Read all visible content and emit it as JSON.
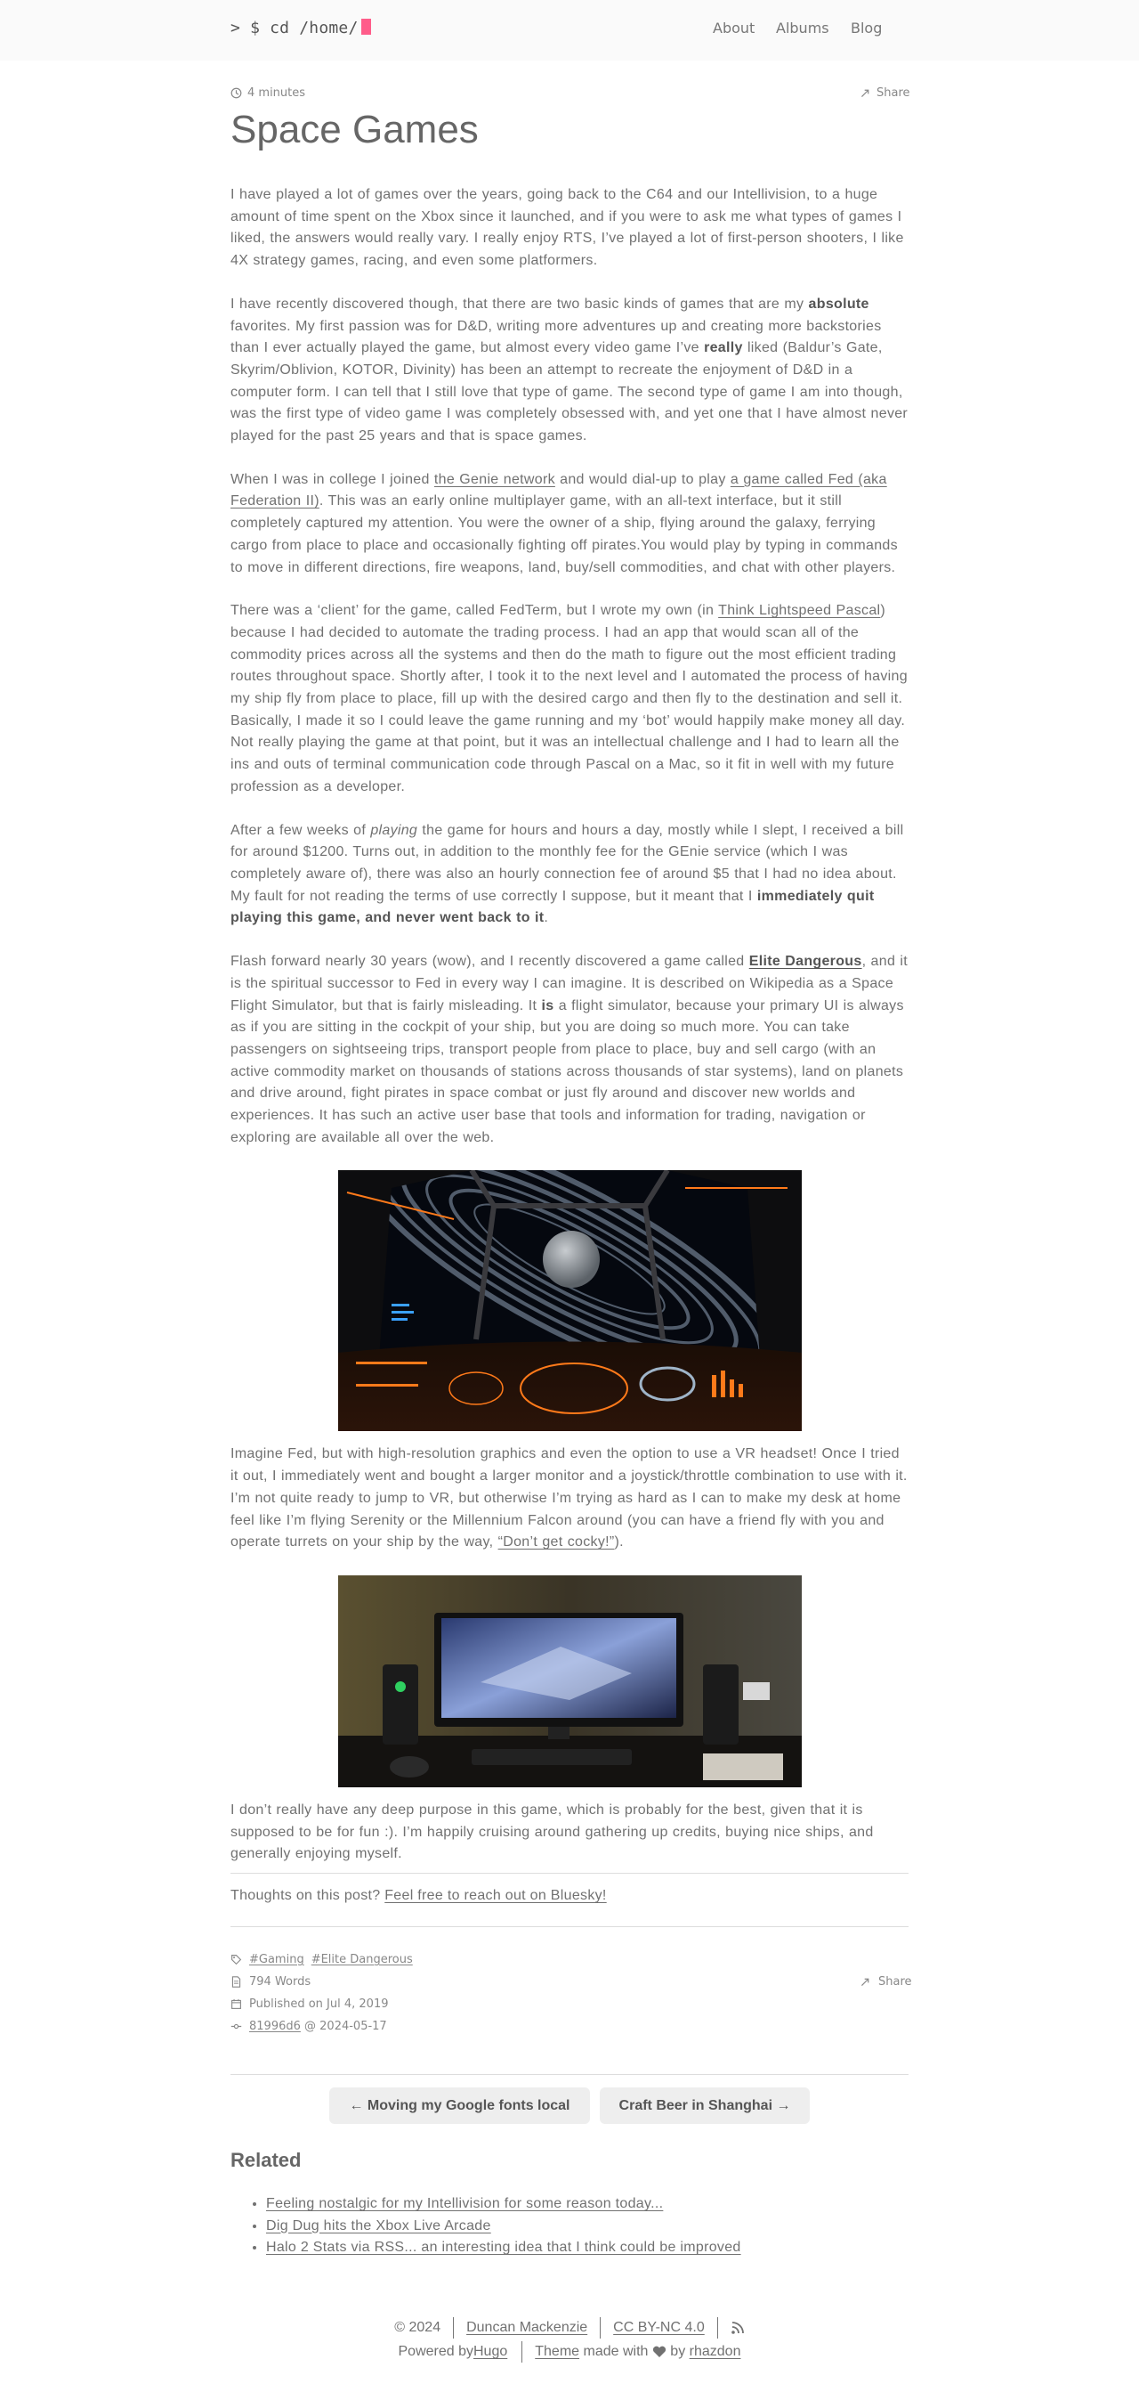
{
  "site": {
    "logo": "> $ cd /home/",
    "nav": [
      "About",
      "Albums",
      "Blog"
    ]
  },
  "post": {
    "reading_time": "4 minutes",
    "share_label": "Share",
    "title": "Space Games"
  },
  "content": {
    "p1": "I have played a lot of games over the years, going back to the C64 and our Intellivision, to a huge amount of time spent on the Xbox since it launched, and if you were to ask me what types of games I liked, the answers would really vary. I really enjoy RTS, I’ve played a lot of first-person shooters, I like 4X strategy games, racing, and even some platformers.",
    "p2_a": "I have recently discovered though, that there are two basic kinds of games that are my ",
    "p2_b": "absolute",
    "p2_c": " favorites. My first passion was for D&D, writing more adventures up and creating more backstories than I ever actually played the game, but almost every video game I’ve ",
    "p2_d": "really",
    "p2_e": " liked (Baldur’s Gate, Skyrim/Oblivion, KOTOR, Divinity) has been an attempt to recreate the enjoyment of D&D in a computer form. I can tell that I still love that type of game. The second type of game I am into though, was the first type of video game I was completely obsessed with, and yet one that I have almost never played for the past 25 years and that is space games.",
    "p3_a": "When I was in college I joined ",
    "p3_link1": "the Genie network",
    "p3_b": " and would dial-up to play ",
    "p3_link2": "a game called Fed (aka Federation II)",
    "p3_c": ". This was an early online multiplayer game, with an all-text interface, but it still completely captured my attention. You were the owner of a ship, flying around the galaxy, ferrying cargo from place to place and occasionally fighting off pirates.You would play by typing in commands to move in different directions, fire weapons, land, buy/sell commodities, and chat with other players.",
    "p4_a": "There was a ‘client’ for the game, called FedTerm, but I wrote my own (in ",
    "p4_link": "Think Lightspeed Pascal",
    "p4_b": ") because I had decided to automate the trading process. I had an app that would scan all of the commodity prices across all the systems and then do the math to figure out the most efficient trading routes throughout space. Shortly after, I took it to the next level and I automated the process of having my ship fly from place to place, fill up with the desired cargo and then fly to the destination and sell it. Basically, I made it so I could leave the game running and my ‘bot’ would happily make money all day. Not really playing the game at that point, but it was an intellectual challenge and I had to learn all the ins and outs of terminal communication code through Pascal on a Mac, so it fit in well with my future profession as a developer.",
    "p5_a": "After a few weeks of ",
    "p5_em": "playing",
    "p5_b": " the game for hours and hours a day, mostly while I slept, I received a bill for around $1200. Turns out, in addition to the monthly fee for the GEnie service (which I was completely aware of), there was also an hourly connection fee of around $5 that I had no idea about. My fault for not reading the terms of use correctly I suppose, but it meant that I ",
    "p5_strong": "immediately quit playing this game, and never went back to it",
    "p5_c": ".",
    "p6_a": "Flash forward nearly 30 years (wow), and I recently discovered a game called ",
    "p6_link": "Elite Dangerous",
    "p6_b": ", and it is the spiritual successor to Fed in every way I can imagine. It is described on Wikipedia as a Space Flight Simulator, but that is fairly misleading. It ",
    "p6_strong": "is",
    "p6_c": " a flight simulator, because your primary UI is always as if you are sitting in the cockpit of your ship, but you are doing so much more. You can take passengers on sightseeing trips, transport people from place to place, buy and sell cargo (with an active commodity market on thousands of stations across thousands of star systems), land on planets and drive around, fight pirates in space combat or just fly around and discover new worlds and experiences. It has such an active user base that tools and information for trading, navigation or exploring are available all over the web.",
    "p7_a": "Imagine Fed, but with high-resolution graphics and even the option to use a VR headset! Once I tried it out, I immediately went and bought a larger monitor and a joystick/throttle combination to use with it. I’m not quite ready to jump to VR, but otherwise I’m trying as hard as I can to make my desk at home feel like I’m flying Serenity or the Millennium Falcon around (you can have a friend fly with you and operate turrets on your ship by the way, ",
    "p7_link": "“Don’t get cocky!”",
    "p7_b": ").",
    "p8": "I don’t really have any deep purpose in this game, which is probably for the best, given that it is supposed to be for fun :). I’m happily cruising around gathering up credits, buying nice ships, and generally enjoying myself."
  },
  "thoughts": {
    "prefix": "Thoughts on this post? ",
    "link": "Feel free to reach out on Bluesky!"
  },
  "meta": {
    "tags": [
      "#Gaming",
      "#Elite Dangerous"
    ],
    "words": "794 Words",
    "published": "Published on Jul 4, 2019",
    "commit_hash": "81996d6",
    "commit_date": " @ 2024-05-17",
    "share_label": "Share"
  },
  "pager": {
    "prev": "← Moving my Google fonts local",
    "next": "Craft Beer in Shanghai →"
  },
  "related": {
    "title": "Related",
    "items": [
      "Feeling nostalgic for my Intellivision for some reason today...",
      "Dig Dug hits the Xbox Live Arcade",
      "Halo 2 Stats via RSS... an interesting idea that I think could be improved"
    ]
  },
  "footer": {
    "copyright": "© 2024",
    "author": "Duncan Mackenzie",
    "license": "CC BY-NC 4.0",
    "powered_prefix": "Powered by ",
    "powered_link": "Hugo",
    "theme_link": "Theme",
    "theme_middle": " made with ",
    "theme_by": " by ",
    "theme_author": "rhazdon"
  },
  "colors": {
    "cursor": "#ff5c8a",
    "topbar_bg": "#fafafa",
    "text": "#717171"
  }
}
